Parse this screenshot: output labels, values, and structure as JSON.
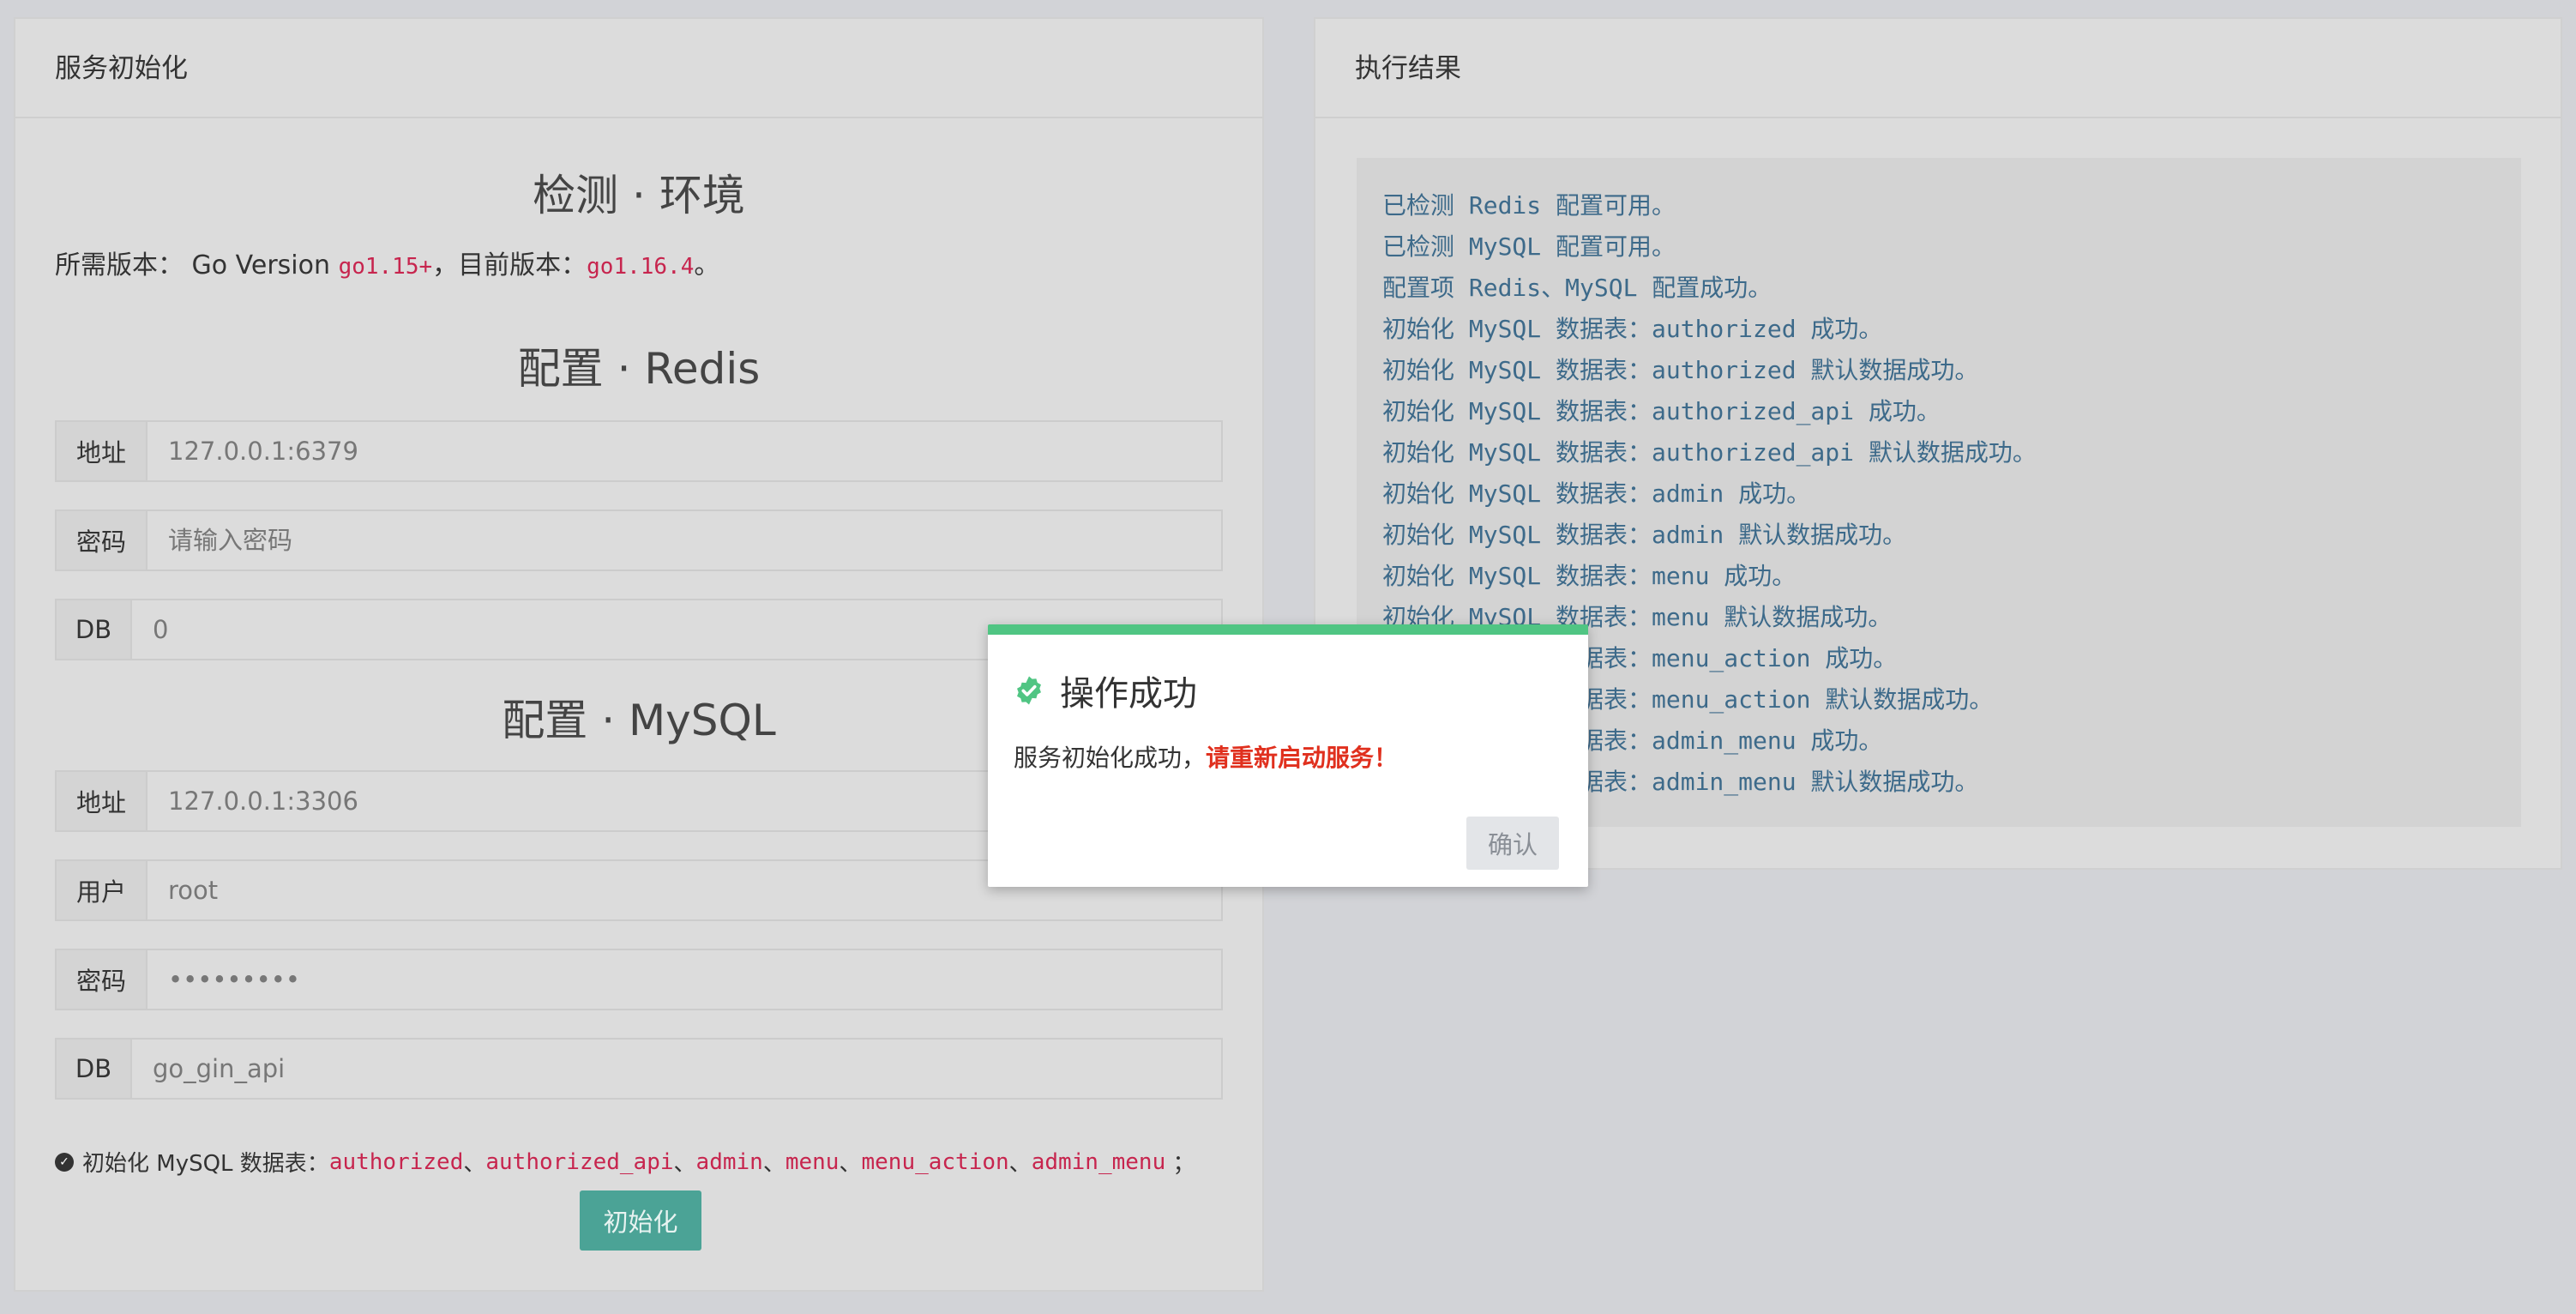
{
  "left_panel": {
    "header": "服务初始化",
    "env_title": "检测 · 环境",
    "version": {
      "required_label": "所需版本：",
      "go_version_text": "Go Version",
      "required_value": "go1.15+",
      "current_label": "，目前版本：",
      "current_value": "go1.16.4",
      "end": "。"
    },
    "redis_title": "配置 · Redis",
    "redis": {
      "address": {
        "label": "地址",
        "value": "127.0.0.1:6379"
      },
      "password": {
        "label": "密码",
        "placeholder": "请输入密码"
      },
      "db": {
        "label": "DB",
        "value": "0"
      }
    },
    "mysql_title": "配置 · MySQL",
    "mysql": {
      "address": {
        "label": "地址",
        "value": "127.0.0.1:3306"
      },
      "user": {
        "label": "用户",
        "value": "root"
      },
      "password": {
        "label": "密码",
        "value": "•••••••••"
      },
      "db": {
        "label": "DB",
        "value": "go_gin_api"
      }
    },
    "tables": {
      "prefix": "初始化 MySQL 数据表：",
      "items": [
        "authorized",
        "authorized_api",
        "admin",
        "menu",
        "menu_action",
        "admin_menu"
      ],
      "sep1": "、 ",
      "sep2": " 、 ",
      "end": "；"
    },
    "init_button": "初始化"
  },
  "right_panel": {
    "header": "执行结果",
    "lines": [
      "已检测 Redis 配置可用。",
      "已检测 MySQL 配置可用。",
      "配置项 Redis、MySQL 配置成功。",
      "初始化 MySQL 数据表：authorized 成功。",
      "初始化 MySQL 数据表：authorized 默认数据成功。",
      "初始化 MySQL 数据表：authorized_api 成功。",
      "初始化 MySQL 数据表：authorized_api 默认数据成功。",
      "初始化 MySQL 数据表：admin 成功。",
      "初始化 MySQL 数据表：admin 默认数据成功。",
      "初始化 MySQL 数据表：menu 成功。",
      "初始化 MySQL 数据表：menu 默认数据成功。",
      "初始化 MySQL 数据表：menu_action 成功。",
      "初始化 MySQL 数据表：menu_action 默认数据成功。",
      "初始化 MySQL 数据表：admin_menu 成功。",
      "初始化 MySQL 数据表：admin_menu 默认数据成功。"
    ]
  },
  "modal": {
    "title": "操作成功",
    "message": "服务初始化成功，",
    "warning": "请重新启动服务！",
    "ok_button": "确认",
    "icon": "check-badge-icon",
    "accent_color": "#50c583"
  }
}
